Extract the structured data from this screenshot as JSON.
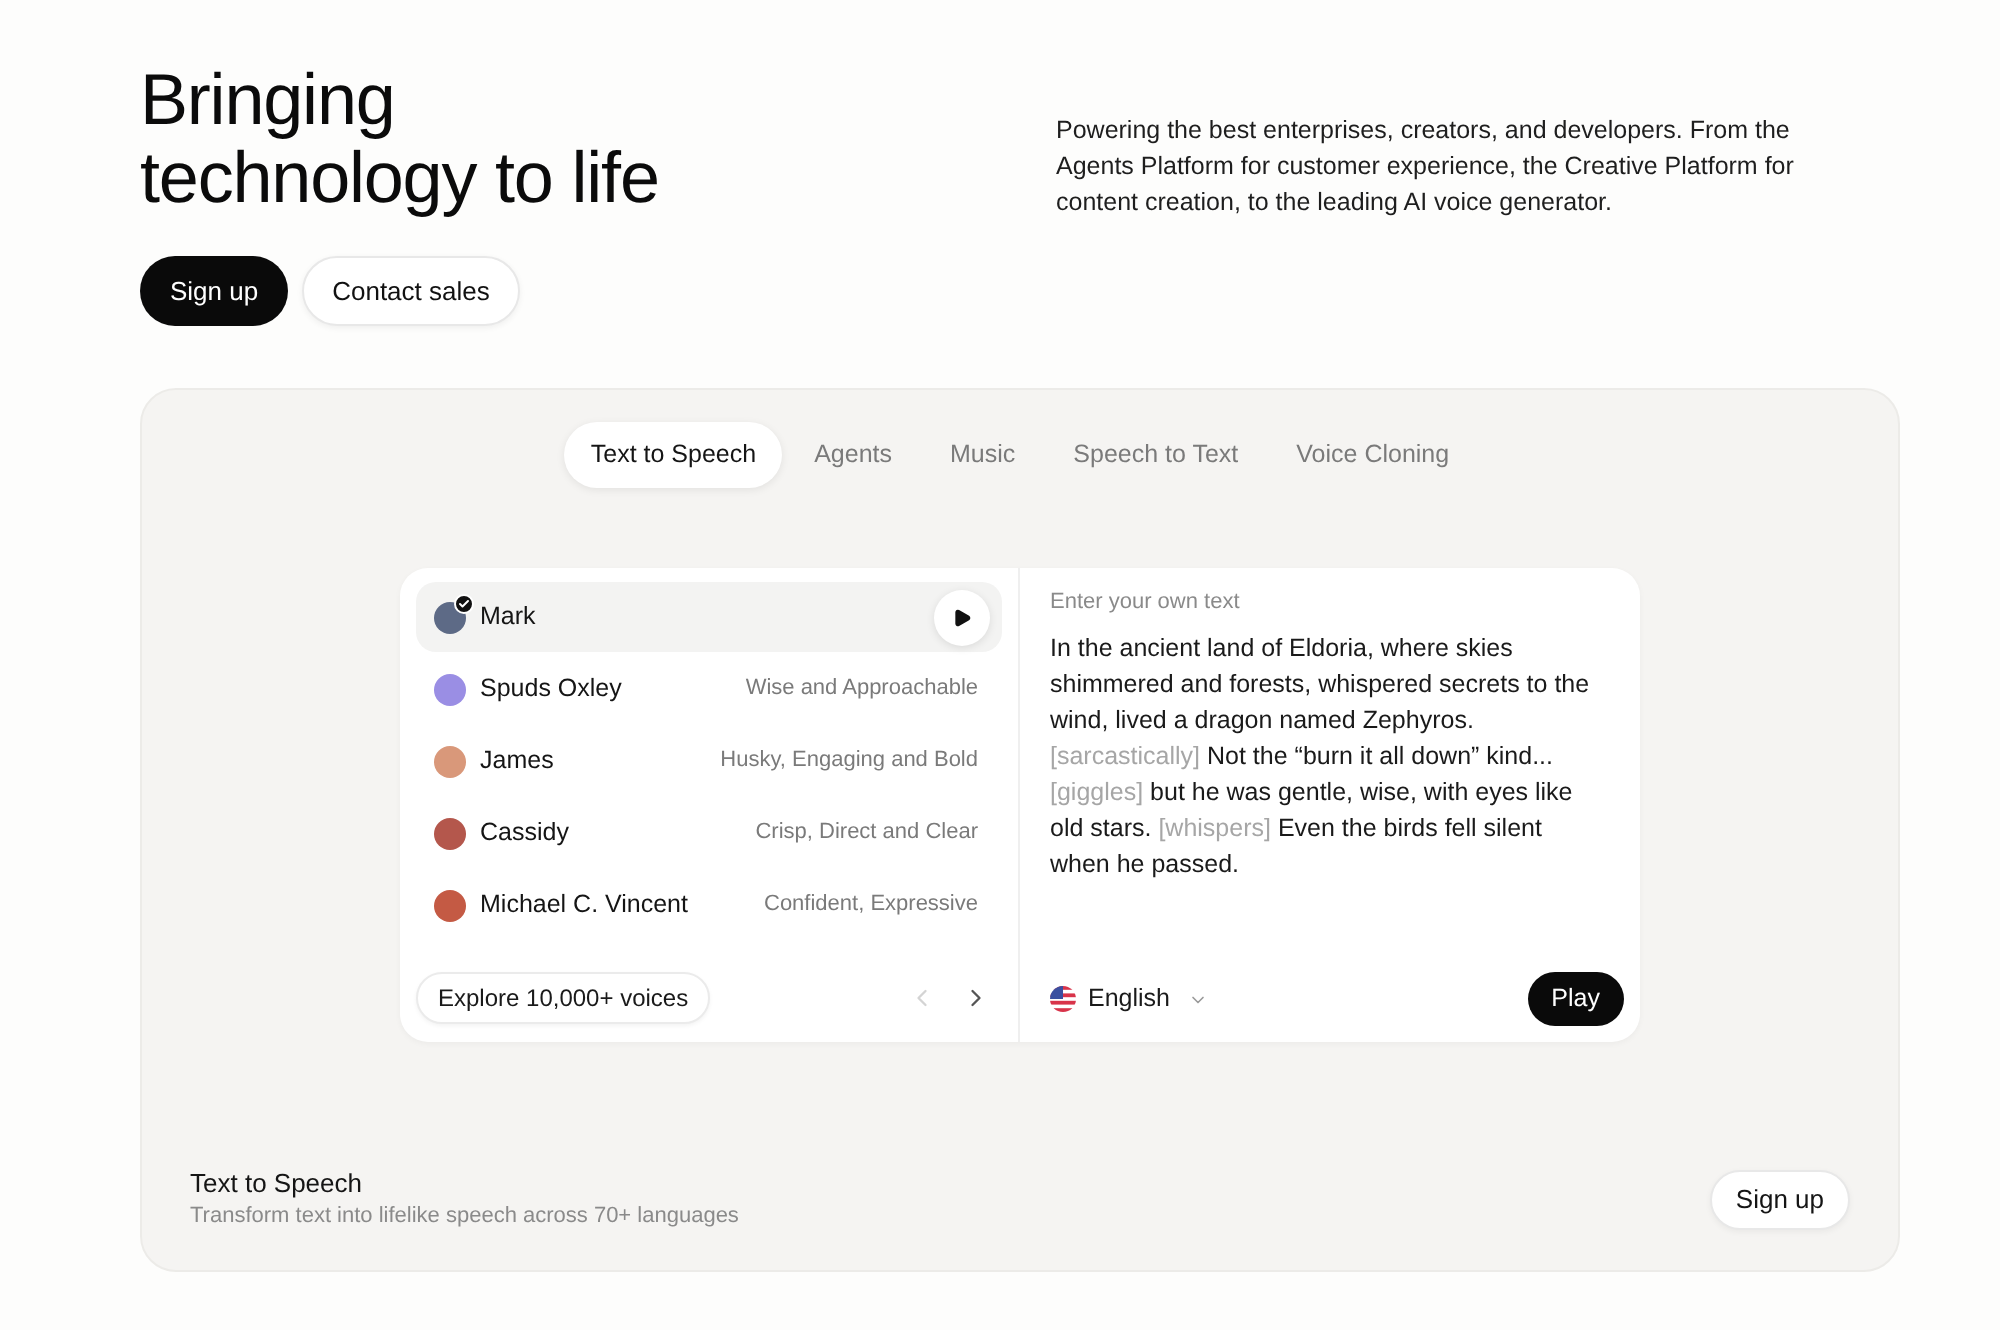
{
  "hero": {
    "title": "Bringing technology to life",
    "description": "Powering the best enterprises, creators, and developers. From the Agents Platform for customer experience, the Creative Platform for content creation, to the leading AI voice generator.",
    "buttons": [
      {
        "label": "Sign up",
        "kind": "primary"
      },
      {
        "label": "Contact sales",
        "kind": "secondary"
      }
    ]
  },
  "demo": {
    "tabs": [
      {
        "label": "Text to Speech",
        "selected": true
      },
      {
        "label": "Agents",
        "selected": false
      },
      {
        "label": "Music",
        "selected": false
      },
      {
        "label": "Speech to Text",
        "selected": false
      },
      {
        "label": "Voice Cloning",
        "selected": false
      }
    ],
    "voices": [
      {
        "name": "Mark",
        "selected": true,
        "color": "#5d6a86"
      },
      {
        "name": "Spuds Oxley",
        "description": "Wise and Approachable",
        "selected": false,
        "color": "#9a8ee4"
      },
      {
        "name": "James",
        "description": "Husky, Engaging and Bold",
        "selected": false,
        "color": "#d9987a"
      },
      {
        "name": "Cassidy",
        "description": "Crisp, Direct and Clear",
        "selected": false,
        "color": "#b4574c"
      },
      {
        "name": "Michael C. Vincent",
        "description": "Confident, Expressive",
        "selected": false,
        "color": "#c45a44"
      }
    ],
    "explore_button": "Explore 10,000+ voices",
    "pager": [
      {
        "kind": "previous",
        "disabled": true
      },
      {
        "kind": "next",
        "disabled": false
      }
    ],
    "editor": {
      "label": "Enter your own text",
      "segments": [
        {
          "kind": "text",
          "text": "In the ancient land of Eldoria, where skies shimmered and forests, whispered secrets to the wind, lived a dragon named Zephyros. "
        },
        {
          "kind": "tag",
          "text": "[sarcastically]"
        },
        {
          "kind": "text",
          "text": " Not the “burn it all down” kind... "
        },
        {
          "kind": "tag",
          "text": "[giggles]"
        },
        {
          "kind": "text",
          "text": " but he was gentle, wise, with eyes like old stars. "
        },
        {
          "kind": "tag",
          "text": "[whispers]"
        },
        {
          "kind": "text",
          "text": " Even the birds fell silent when he passed."
        }
      ]
    },
    "language": "English",
    "play_button": "Play",
    "footer": {
      "title": "Text to Speech",
      "subtitle": "Transform text into lifelike speech across 70+ languages",
      "button": "Sign up"
    }
  }
}
